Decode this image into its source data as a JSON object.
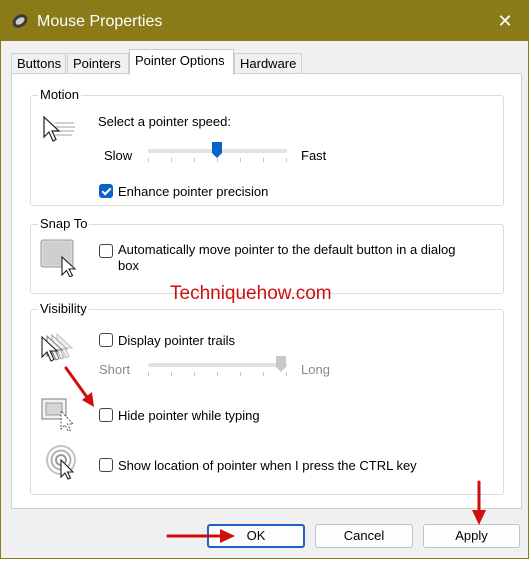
{
  "window": {
    "title": "Mouse Properties",
    "close_glyph": "✕"
  },
  "tabs": [
    {
      "label": "Buttons"
    },
    {
      "label": "Pointers"
    },
    {
      "label": "Pointer Options",
      "selected": true
    },
    {
      "label": "Hardware"
    }
  ],
  "motion": {
    "group_label": "Motion",
    "speed_label": "Select a pointer speed:",
    "slow_label": "Slow",
    "fast_label": "Fast",
    "speed_value_fraction": 0.6,
    "enhance_label": "Enhance pointer precision",
    "enhance_checked": true
  },
  "snap": {
    "group_label": "Snap To",
    "auto_label_line1": "Automatically move pointer to the default button in a dialog",
    "auto_label_line2": "box",
    "auto_checked": false
  },
  "visibility": {
    "group_label": "Visibility",
    "trails_label": "Display pointer trails",
    "trails_checked": false,
    "short_label": "Short",
    "long_label": "Long",
    "trails_value_fraction": 1.0,
    "hide_label": "Hide pointer while typing",
    "hide_checked": false,
    "show_location_label": "Show location of pointer when I press the CTRL key",
    "show_location_checked": false
  },
  "watermark": "Techniquehow.com",
  "buttons": {
    "ok": "OK",
    "cancel": "Cancel",
    "apply": "Apply"
  },
  "colors": {
    "titlebar": "#8a7a18",
    "accent": "#0a64c8",
    "annotation": "#ce0f0f"
  }
}
